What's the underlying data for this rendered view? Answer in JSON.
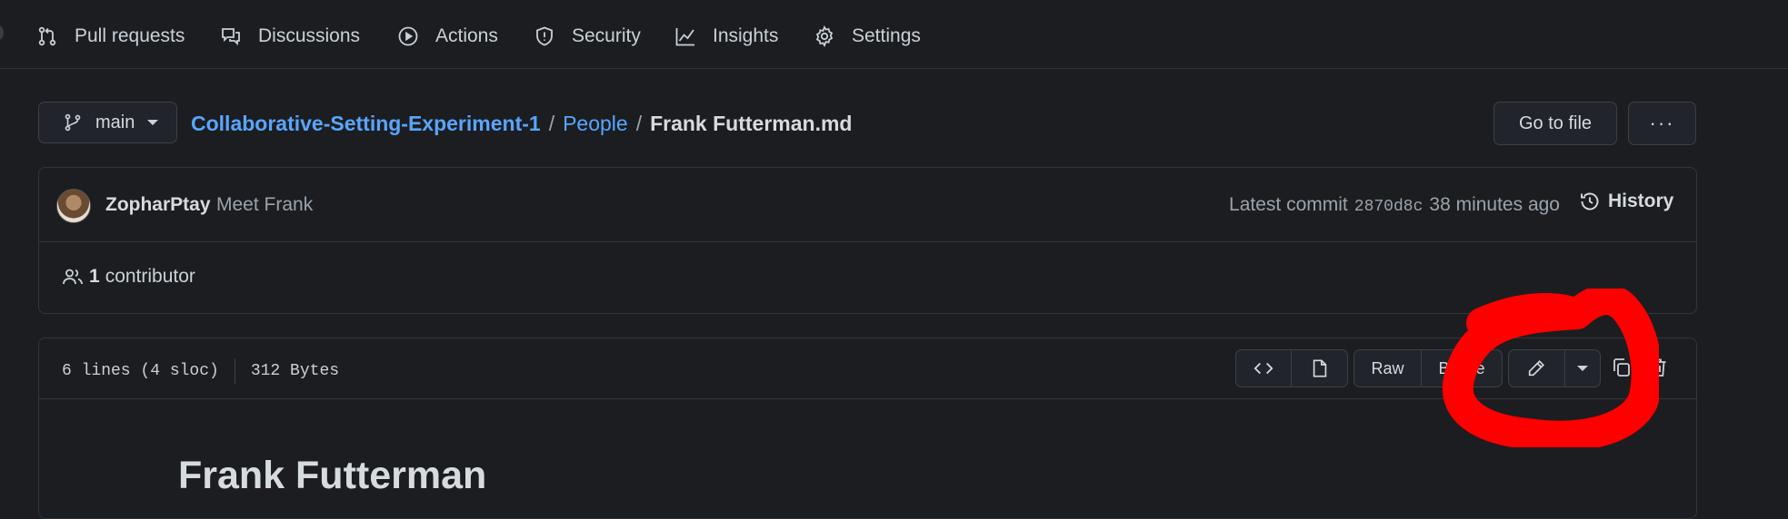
{
  "nav": {
    "items": [
      {
        "label": "Pull requests",
        "icon": "pull-request-icon"
      },
      {
        "label": "Discussions",
        "icon": "discussions-icon"
      },
      {
        "label": "Actions",
        "icon": "actions-icon"
      },
      {
        "label": "Security",
        "icon": "shield-icon"
      },
      {
        "label": "Insights",
        "icon": "graph-icon"
      },
      {
        "label": "Settings",
        "icon": "gear-icon"
      }
    ]
  },
  "branch": {
    "label": "main",
    "icon": "git-branch-icon"
  },
  "breadcrumb": {
    "repo": "Collaborative-Setting-Experiment-1",
    "sep": "/",
    "folder": "People",
    "file": "Frank Futterman.md"
  },
  "header_actions": {
    "go_to_file": "Go to file",
    "more": "···"
  },
  "commit": {
    "author": "ZopharPtay",
    "message": "Meet Frank",
    "latest_label": "Latest commit",
    "sha": "2870d8c",
    "time": "38 minutes ago",
    "history_label": "History"
  },
  "contributors": {
    "count": "1",
    "label": "contributor"
  },
  "file": {
    "lines": "6 lines (4 sloc)",
    "size": "312 Bytes",
    "raw_label": "Raw",
    "blame_label": "Blame"
  },
  "markdown": {
    "title": "Frank Futterman"
  },
  "annotation": {
    "color": "#ff0000"
  }
}
